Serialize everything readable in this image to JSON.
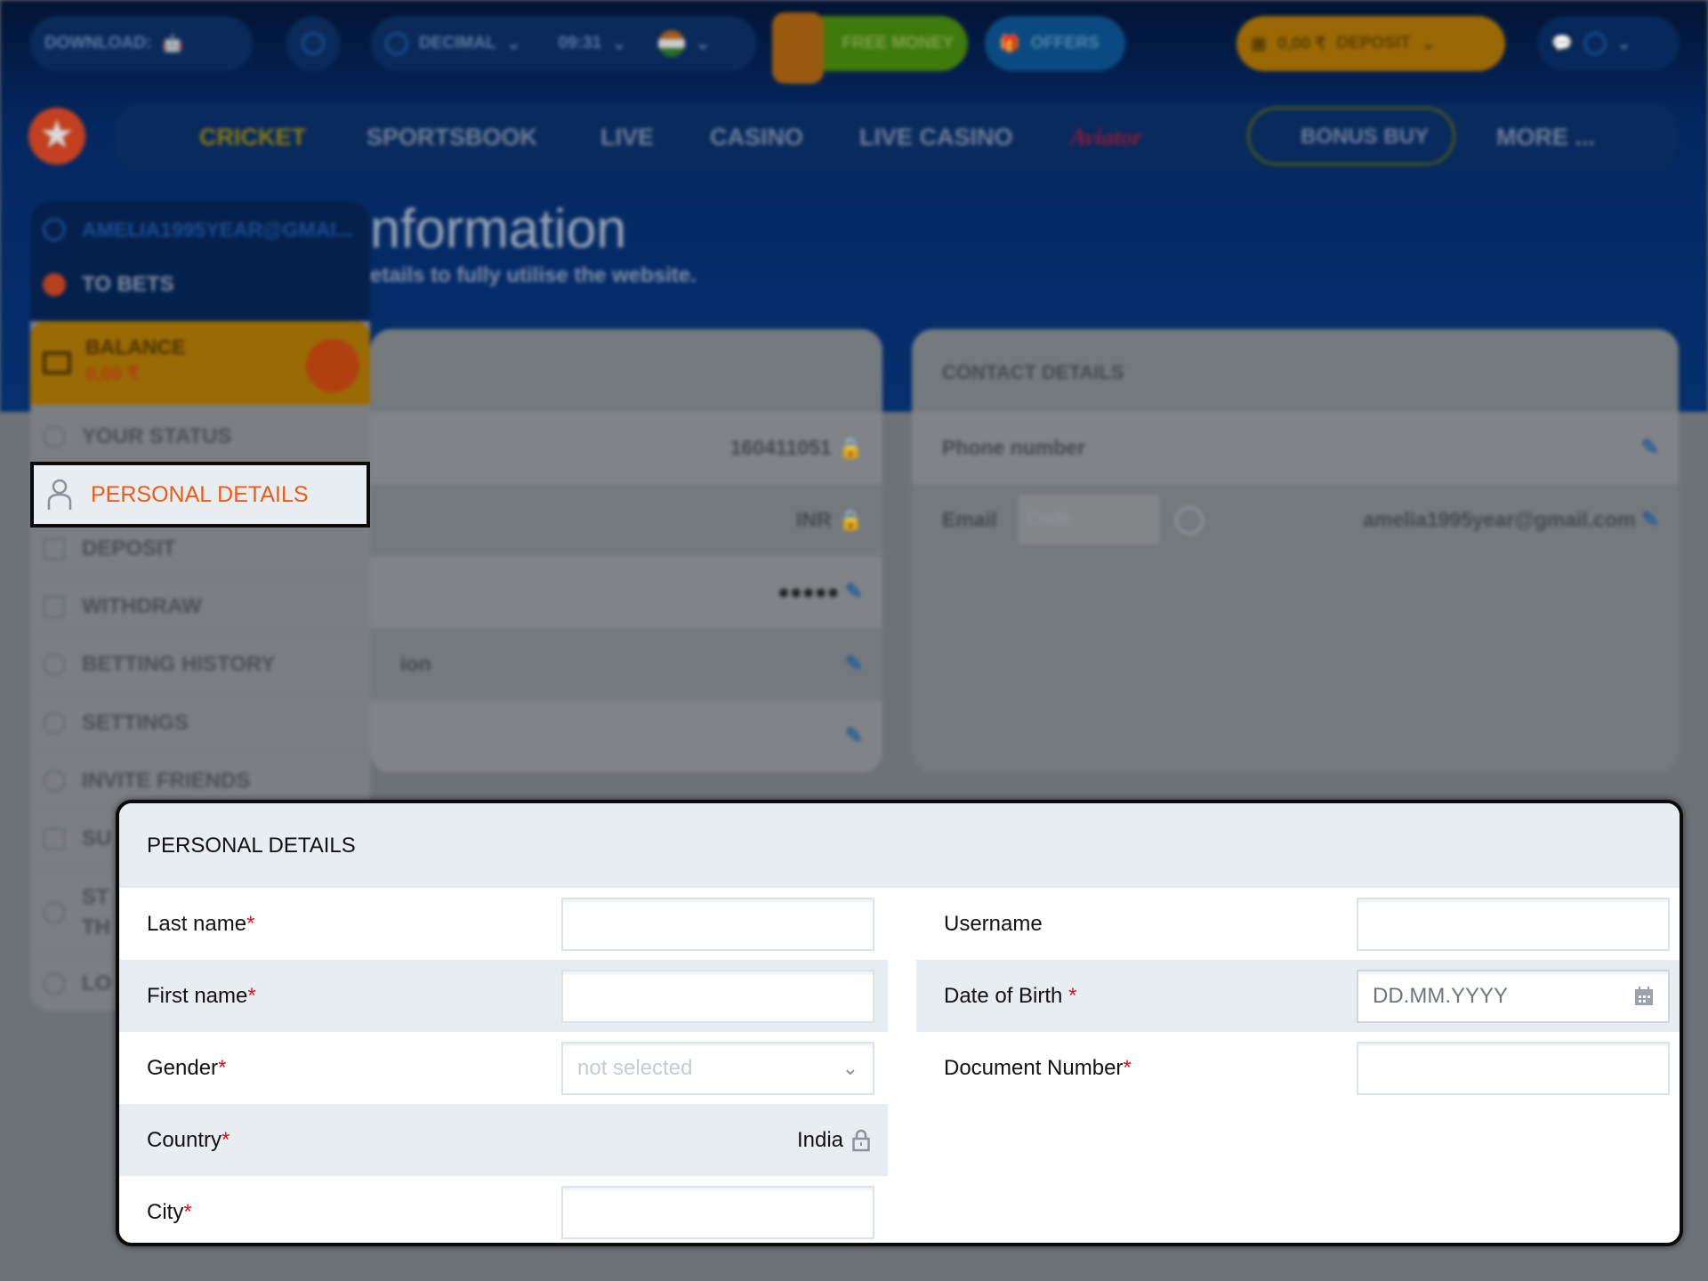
{
  "topbar": {
    "download_label": "DOWNLOAD:",
    "odds_format": "DECIMAL",
    "time": "09:31",
    "free_money": "FREE MONEY",
    "offers": "OFFERS",
    "balance": "0,00 ₹",
    "deposit": "DEPOSIT"
  },
  "nav": {
    "items": [
      "CRICKET",
      "SPORTSBOOK",
      "LIVE",
      "CASINO",
      "LIVE CASINO",
      "Aviator",
      "BONUS BUY",
      "MORE ..."
    ]
  },
  "page": {
    "title": "nformation",
    "subtitle": "etails to fully utilise the website."
  },
  "sidebar": {
    "email": "AMELIA1995YEAR@GMAI...",
    "to_bets": "TO BETS",
    "balance_label": "BALANCE",
    "balance_amount": "0,00 ₹",
    "items": [
      "YOUR STATUS",
      "PERSONAL DETAILS",
      "DEPOSIT",
      "WITHDRAW",
      "BETTING HISTORY",
      "SETTINGS",
      "INVITE FRIENDS",
      "SU",
      "ST TH",
      "LO"
    ]
  },
  "account_card": {
    "rows": [
      {
        "label": "",
        "value": "160411051"
      },
      {
        "label": "",
        "value": "INR"
      },
      {
        "label": "",
        "value": "●●●●●"
      },
      {
        "label": "ion",
        "value": ""
      },
      {
        "label": "",
        "value": ""
      }
    ]
  },
  "contact_card": {
    "title": "CONTACT DETAILS",
    "phone_label": "Phone number",
    "email_label": "Email",
    "code_placeholder": "Code",
    "email_value": "amelia1995year@gmail.com"
  },
  "modal": {
    "title": "PERSONAL DETAILS",
    "last_name": "Last name",
    "first_name": "First name",
    "gender": "Gender",
    "gender_value": "not selected",
    "country": "Country",
    "country_value": "India",
    "city": "City",
    "username": "Username",
    "dob": "Date of Birth",
    "dob_placeholder": "DD.MM.YYYY",
    "document": "Document Number",
    "required_mark": "*"
  },
  "colors": {
    "accent_orange": "#f05a14",
    "deposit_yellow": "#f0a500",
    "required_red": "#e0141e"
  }
}
